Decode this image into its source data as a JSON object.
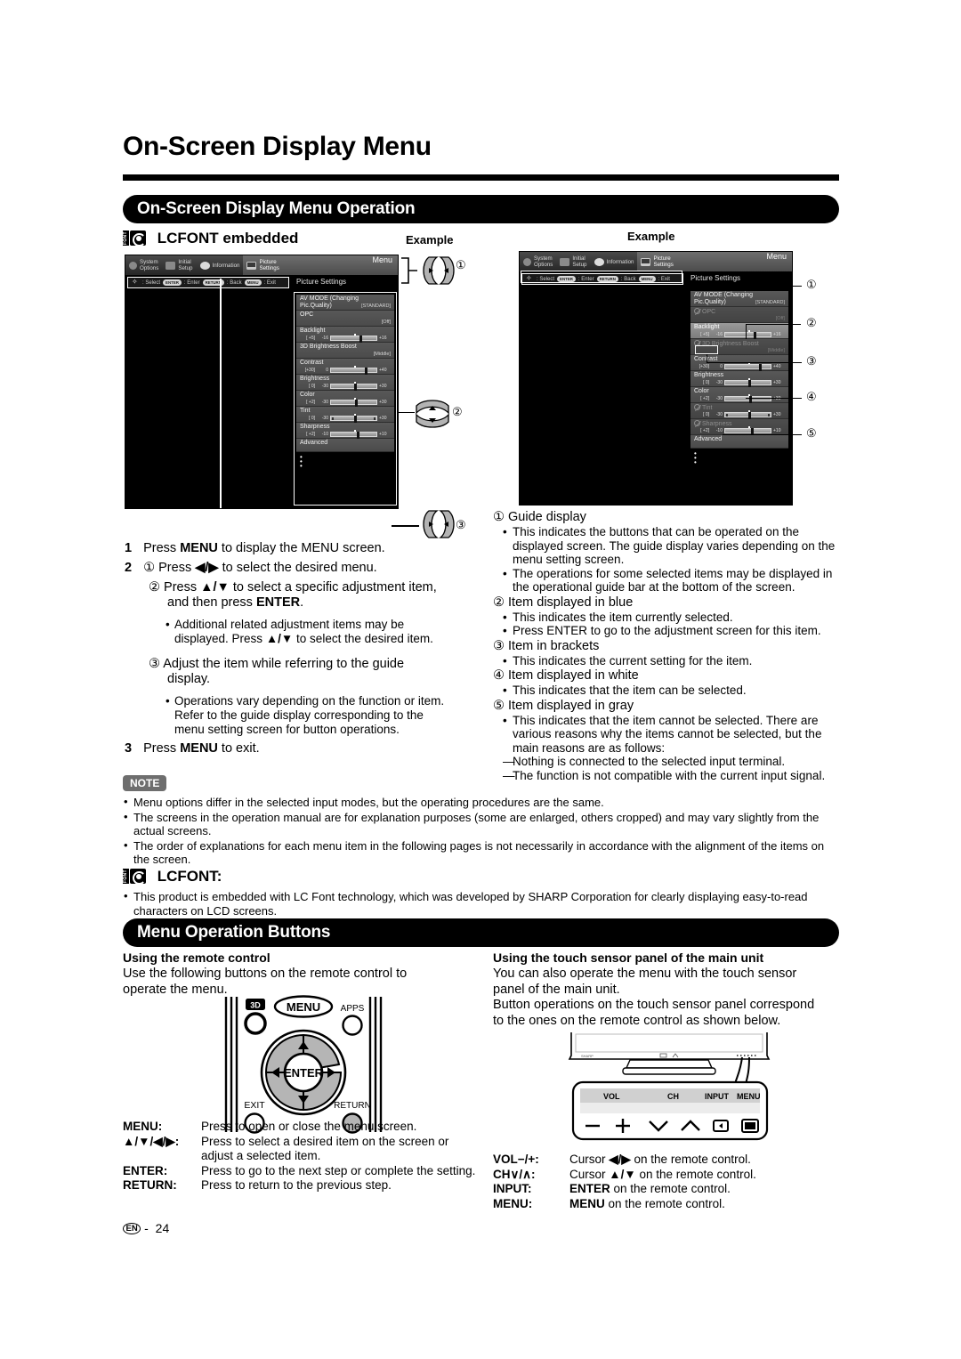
{
  "page": {
    "title": "On-Screen Display Menu",
    "footer_lang": "EN",
    "footer_sep": "-",
    "footer_number": "24"
  },
  "sections": {
    "osd_operation": "On-Screen Display Menu Operation",
    "menu_operation_buttons": "Menu Operation Buttons"
  },
  "lcfont": {
    "embedded_label": "LCFONT embedded",
    "heading": "LCFONT:",
    "mark_text": "FONT",
    "body": "This product is embedded with LC Font technology, which was developed by SHARP Corporation for clearly displaying easy-to-read characters on LCD screens."
  },
  "example_label_left": "Example",
  "example_label_right": "Example",
  "osd": {
    "tabs": [
      {
        "line1": "System",
        "line2": "Options",
        "icon": "system-options-icon"
      },
      {
        "line1": "Initial",
        "line2": "Setup",
        "icon": "initial-setup-icon"
      },
      {
        "line1": "Information",
        "line2": "",
        "icon": "information-icon"
      },
      {
        "line1": "Picture",
        "line2": "Settings",
        "icon": "picture-settings-icon"
      }
    ],
    "menu_word": "Menu",
    "guide": {
      "select": "Select",
      "enter_key": "ENTER",
      "enter": "Enter",
      "back_key": "RETURN",
      "back": "Back",
      "exit_key": "MENU",
      "exit": "Exit"
    },
    "subtitle": "Picture Settings",
    "rows": [
      {
        "name": "AV MODE (Changing Pic.Quality)",
        "value": "[STANDARD]",
        "type": "value",
        "state_left": "normal",
        "state_right": "normal"
      },
      {
        "name": "OPC",
        "value": "[Off]",
        "type": "value",
        "state_left": "normal",
        "state_right": "gray"
      },
      {
        "name": "Backlight",
        "type": "slider",
        "bracket": "[ +5]",
        "min": "-16",
        "max": "+16",
        "knob": 62,
        "dot": 50,
        "state_left": "normal",
        "state_right": "selected"
      },
      {
        "name": "3D Brightness Boost",
        "value": "[Middle]",
        "type": "value",
        "state_left": "normal",
        "state_right": "gray"
      },
      {
        "name": "Contrast",
        "type": "slider",
        "bracket": "[+30]",
        "min": "0",
        "max": "+40",
        "knob": 75,
        "dot": 50,
        "state_left": "normal",
        "state_right": "normal"
      },
      {
        "name": "Brightness",
        "type": "slider",
        "bracket": "[  0]",
        "min": "-30",
        "max": "+30",
        "knob": 50,
        "dot": 50,
        "state_left": "normal",
        "state_right": "normal"
      },
      {
        "name": "Color",
        "type": "slider",
        "bracket": "[ +2]",
        "min": "-30",
        "max": "+30",
        "knob": 53,
        "dot": 50,
        "state_left": "normal",
        "state_right": "normal"
      },
      {
        "name": "Tint",
        "type": "slider",
        "bracket": "[  0]",
        "min": "-30",
        "max": "+30",
        "knob": 50,
        "dot": 50,
        "ends": true,
        "state_left": "normal",
        "state_right": "gray"
      },
      {
        "name": "Sharpness",
        "type": "slider",
        "bracket": "[ +2]",
        "min": "-10",
        "max": "+10",
        "knob": 57,
        "dot": 50,
        "state_left": "normal",
        "state_right": "gray"
      },
      {
        "name": "Advanced",
        "type": "plain",
        "state_left": "normal",
        "state_right": "normal"
      }
    ]
  },
  "callouts": {
    "one": "①",
    "two": "②",
    "three": "③",
    "four": "④",
    "five": "⑤"
  },
  "steps": {
    "s1_num": "1",
    "s1_a": "Press ",
    "s1_b": "MENU",
    "s1_c": " to display the MENU screen.",
    "s2_num": "2",
    "s2a_circ": "①",
    "s2a_a": "Press ",
    "s2a_keys": "◀/▶",
    "s2a_b": " to select the desired menu.",
    "s2b_circ": "②",
    "s2b_a": "Press ",
    "s2b_keys": "▲/▼",
    "s2b_b": " to select a specific adjustment item,",
    "s2b_c": "and then press ",
    "s2b_bold": "ENTER",
    "s2b_d": ".",
    "s2b_bullet_a": "Additional related adjustment items may be",
    "s2b_bullet_b": "displayed. Press ",
    "s2b_bullet_keys": "▲/▼",
    "s2b_bullet_c": " to select the desired item.",
    "s2c_circ": "③",
    "s2c_a": "Adjust the item while referring to the guide",
    "s2c_b": "display.",
    "s2c_bullet_a": "Operations vary depending on the function or item.",
    "s2c_bullet_b": "Refer to the guide display corresponding to the",
    "s2c_bullet_c": "menu setting screen for button operations.",
    "s3_num": "3",
    "s3_a": "Press ",
    "s3_b": "MENU",
    "s3_c": " to exit."
  },
  "legend": [
    {
      "num": "①",
      "title": "Guide display",
      "bullets": [
        "This indicates the buttons that can be operated on the displayed screen. The guide display varies depending on the menu setting screen.",
        "The operations for some selected items may be displayed in the operational guide bar at the bottom of the screen."
      ]
    },
    {
      "num": "②",
      "title": "Item displayed in blue",
      "bullets": [
        "This indicates the item currently selected.",
        "Press ENTER to go to the adjustment screen for this item."
      ]
    },
    {
      "num": "③",
      "title": "Item in brackets",
      "bullets": [
        "This indicates the current setting for the item."
      ]
    },
    {
      "num": "④",
      "title": "Item displayed in white",
      "bullets": [
        "This indicates that the item can be selected."
      ]
    },
    {
      "num": "⑤",
      "title": "Item displayed in gray",
      "bullets": [
        "This indicates that the item cannot be selected. There are various reasons why the items cannot be selected, but the main reasons are as follows:"
      ],
      "dashes": [
        "Nothing is connected to the selected input terminal.",
        "The function is not compatible with the current input signal."
      ]
    }
  ],
  "note": {
    "badge": "NOTE",
    "items": [
      "Menu options differ in the selected input modes, but the operating procedures are the same.",
      "The screens in the operation manual are for explanation purposes (some are enlarged, others cropped) and may vary slightly from the actual screens.",
      "The order of explanations for each menu item in the following pages is not necessarily in accordance with the alignment of the items on the screen."
    ]
  },
  "remote_section": {
    "heading": "Using the remote control",
    "body_a": "Use the following buttons on the remote control to",
    "body_b": "operate the menu.",
    "buttons": {
      "threed": "3D",
      "menu": "MENU",
      "apps": "APPS",
      "enter": "ENTER",
      "exit": "EXIT",
      "return": "RETURN"
    },
    "keys": [
      {
        "label": "MENU:",
        "desc": "Press to open or close the menu screen."
      },
      {
        "label": "▲/▼/◀/▶:",
        "desc": "Press to select a desired item on the screen or adjust a selected item."
      },
      {
        "label": "ENTER:",
        "desc": "Press to go to the next step or complete the setting."
      },
      {
        "label": "RETURN:",
        "desc": "Press to return to the previous step."
      }
    ]
  },
  "touch_section": {
    "heading": "Using the touch sensor panel of the main unit",
    "body_a": "You can also operate the menu with the touch sensor",
    "body_b": "panel of the main unit.",
    "body_c": "Button operations on the touch sensor panel correspond",
    "body_d": "to the ones on the remote control as shown below.",
    "panel_labels": [
      "VOL",
      "CH",
      "INPUT",
      "MENU"
    ],
    "panel_glyphs": [
      "−",
      "+",
      "∨",
      "∧",
      "input-icon",
      "menu-icon"
    ],
    "keys": [
      {
        "label": "VOL−/+:",
        "desc_pre": "Cursor ",
        "desc_keys": "◀/▶",
        "desc_post": " on the remote control."
      },
      {
        "label": "CH∨/∧:",
        "desc_pre": "Cursor ",
        "desc_keys": "▲/▼",
        "desc_post": " on the remote control."
      },
      {
        "label": "INPUT:",
        "desc_pre": "",
        "desc_keys": "ENTER",
        "desc_post": " on the remote control."
      },
      {
        "label": "MENU:",
        "desc_pre": "",
        "desc_keys": "MENU",
        "desc_post": " on the remote control."
      }
    ]
  }
}
